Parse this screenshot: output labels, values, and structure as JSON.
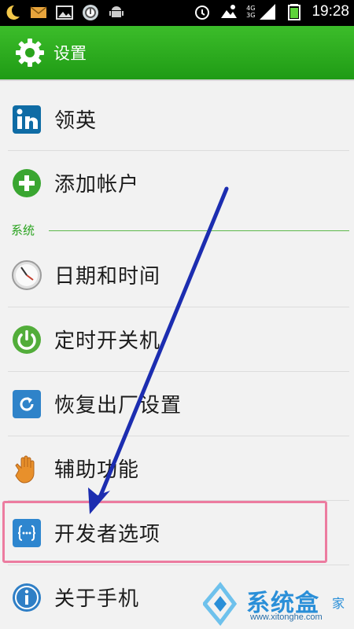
{
  "status_bar": {
    "time": "19:28",
    "network_top": "4G",
    "network_bottom": "3G",
    "icons": [
      "moon-icon",
      "mail-icon",
      "image-icon",
      "circle-app-icon",
      "android-icon",
      "alarm-icon",
      "weather-icon",
      "signal-icon",
      "battery-icon"
    ]
  },
  "action_bar": {
    "title": "设置",
    "icon": "gear-icon"
  },
  "items": [
    {
      "label": "领英",
      "icon": "linkedin-icon"
    },
    {
      "label": "添加帐户",
      "icon": "add-account-icon"
    },
    {
      "label": "日期和时间",
      "icon": "clock-icon"
    },
    {
      "label": "定时开关机",
      "icon": "power-icon"
    },
    {
      "label": "恢复出厂设置",
      "icon": "reset-icon"
    },
    {
      "label": "辅助功能",
      "icon": "hand-icon"
    },
    {
      "label": "开发者选项",
      "icon": "developer-icon"
    },
    {
      "label": "关于手机",
      "icon": "info-icon"
    }
  ],
  "section": {
    "system": "系统"
  },
  "watermark": {
    "text": "系统盒",
    "small": "家",
    "url": "www.xitonghe.com"
  },
  "colors": {
    "accent": "#1f9b15",
    "highlight": "#ec7ca0",
    "arrow": "#1c2db0"
  }
}
